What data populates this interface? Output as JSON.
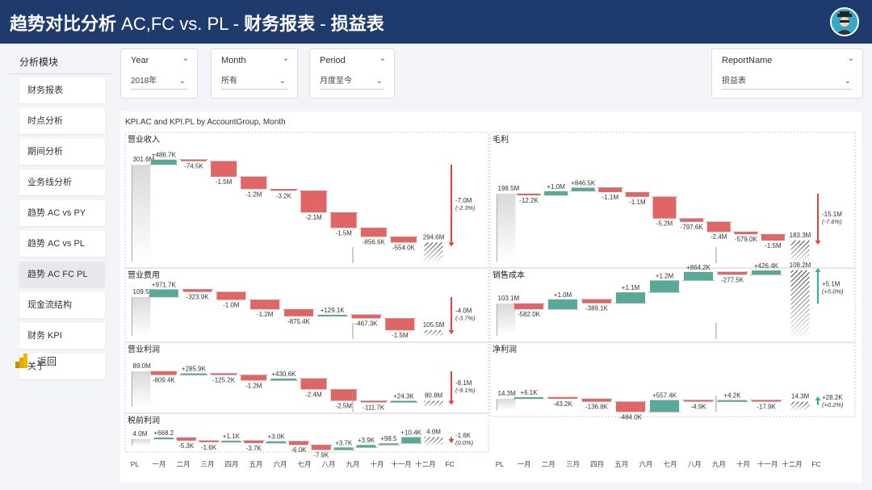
{
  "header": {
    "title_part1": "趋势对比分析",
    "title_part2": "AC,FC vs. PL",
    "title_sep": "-",
    "title_part3": "财务报表",
    "title_part4": "损益表"
  },
  "sidebar": {
    "title": "分析模块",
    "items": [
      {
        "label": "财务报表"
      },
      {
        "label": "时点分析"
      },
      {
        "label": "期间分析"
      },
      {
        "label": "业务线分析"
      },
      {
        "label": "趋势 AC vs PY"
      },
      {
        "label": "趋势 AC vs PL"
      },
      {
        "label": "趋势 AC FC PL",
        "active": true
      },
      {
        "label": "现金流结构"
      },
      {
        "label": "财务 KPI"
      },
      {
        "label": "关于"
      }
    ],
    "back_label": "返回"
  },
  "slicers": {
    "year": {
      "label": "Year",
      "value": "2018年"
    },
    "month": {
      "label": "Month",
      "value": "所有"
    },
    "period": {
      "label": "Period",
      "value": "月度至今"
    },
    "report": {
      "label": "ReportName",
      "value": "损益表"
    }
  },
  "colors": {
    "header_bg": "#1f3b6e",
    "positive": "#5aa897",
    "negative": "#e06666",
    "positive_arrow": "#2bb5a0",
    "negative_arrow": "#e04040"
  },
  "chart_data": {
    "type": "bar",
    "title": "KPI.AC and KPI.PL by AccountGroup, Month",
    "categories": [
      "PL",
      "一月",
      "二月",
      "三月",
      "四月",
      "五月",
      "六月",
      "七月",
      "八月",
      "九月",
      "十月",
      "十一月",
      "十二月",
      "FC"
    ],
    "panels": [
      {
        "name": "营业收入",
        "start": "301.6M",
        "start_v": 301.6,
        "end": "294.6M",
        "deltas": [
          "+486.7K",
          "-74.5K",
          "-1.5M",
          "-1.2M",
          "-3.2K",
          "-2.1M",
          "-1.5M",
          "-856.6K",
          "-554.0K"
        ],
        "delta_v": [
          0.49,
          -0.07,
          -1.5,
          -1.2,
          -0.003,
          -2.1,
          -1.5,
          -0.86,
          -0.55
        ],
        "variance": "-7.0M",
        "variance_pct": "(-2.3%)",
        "direction": "down"
      },
      {
        "name": "毛利",
        "start": "198.5M",
        "start_v": 198.5,
        "end": "183.3M",
        "deltas": [
          "-12.2K",
          "+1.0M",
          "+846.5K",
          "-1.1M",
          "-1.1M",
          "-5.2M",
          "-797.6K",
          "-2.4M",
          "-579.0K",
          "-1.5M"
        ],
        "delta_v": [
          -0.01,
          1.0,
          0.85,
          -1.1,
          -1.1,
          -5.2,
          -0.8,
          -2.4,
          -0.58,
          -1.5
        ],
        "variance": "-15.1M",
        "variance_pct": "(-7.6%)",
        "direction": "down"
      },
      {
        "name": "营业费用",
        "start": "109.5M",
        "start_v": 109.5,
        "end": "105.5M",
        "deltas": [
          "+971.7K",
          "-323.9K",
          "-1.0M",
          "-1.2M",
          "-875.4K",
          "+129.1K",
          "-467.3K",
          "-1.5M"
        ],
        "delta_v": [
          0.97,
          -0.32,
          -1.0,
          -1.2,
          -0.88,
          0.13,
          -0.47,
          -1.5
        ],
        "variance": "-4.0M",
        "variance_pct": "(-3.7%)",
        "direction": "down"
      },
      {
        "name": "销售成本",
        "start": "103.1M",
        "start_v": 103.1,
        "end": "108.2M",
        "deltas": [
          "-582.0K",
          "+1.0M",
          "-389.1K",
          "+1.1M",
          "+1.2M",
          "+864.2K",
          "-277.5K",
          "+426.4K"
        ],
        "delta_v": [
          -0.58,
          1.0,
          -0.39,
          1.1,
          1.2,
          0.86,
          -0.28,
          0.43
        ],
        "variance": "+5.1M",
        "variance_pct": "(+5.0%)",
        "direction": "up"
      },
      {
        "name": "营业利润",
        "start": "89.0M",
        "start_v": 89.0,
        "end": "80.8M",
        "deltas": [
          "-809.4K",
          "+285.9K",
          "-125.2K",
          "-1.2M",
          "+430.6K",
          "-2.4M",
          "-2.5M",
          "-111.7K",
          "+24.3K"
        ],
        "delta_v": [
          -0.81,
          0.29,
          -0.13,
          -1.2,
          0.43,
          -2.4,
          -2.5,
          -0.11,
          0.02
        ],
        "variance": "-8.1M",
        "variance_pct": "(-9.1%)",
        "direction": "down"
      },
      {
        "name": "净利润",
        "start": "14.3M",
        "start_v": 14.3,
        "end": "14.3M",
        "deltas": [
          "+6.1K",
          "-43.2K",
          "-136.8K",
          "-484.0K",
          "+557.4K",
          "-4.9K",
          "+4.2K",
          "-17.9K"
        ],
        "delta_v": [
          0.006,
          -0.04,
          -0.14,
          -0.48,
          0.56,
          -0.005,
          0.004,
          -0.02
        ],
        "variance": "+28.2K",
        "variance_pct": "(+0.2%)",
        "direction": "up"
      },
      {
        "name": "税前利润",
        "start": "4.0M",
        "start_v": 4.0,
        "end": "4.0M",
        "deltas": [
          "+668.2",
          "-5.3K",
          "-1.6K",
          "+1.1K",
          "-3.7K",
          "+3.0K",
          "-6.0K",
          "-7.9K",
          "+3.7K",
          "+3.9K",
          "+98.5",
          "+10.4K"
        ],
        "delta_v": [
          0.0007,
          -0.005,
          -0.002,
          0.001,
          -0.004,
          0.003,
          -0.006,
          -0.008,
          0.004,
          0.004,
          0.0001,
          0.01
        ],
        "variance": "-1.6K",
        "variance_pct": "(0.0%)",
        "direction": "down"
      }
    ]
  }
}
